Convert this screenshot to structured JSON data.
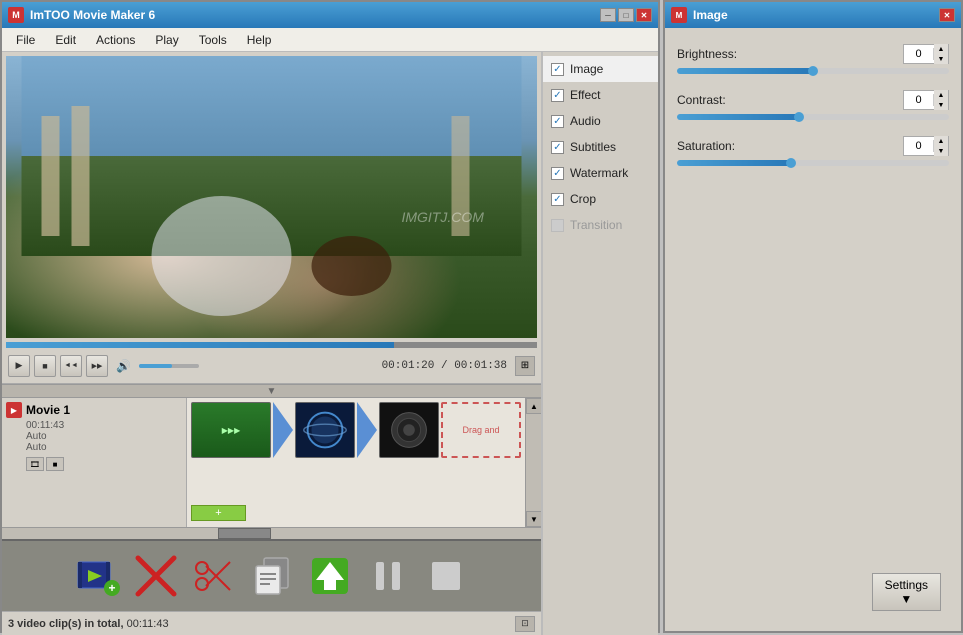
{
  "main_window": {
    "title": "ImTOO Movie Maker 6",
    "icon": "M",
    "controls": {
      "minimize": "─",
      "maximize": "□",
      "close": "✕"
    }
  },
  "menu": {
    "items": [
      {
        "label": "File",
        "id": "file"
      },
      {
        "label": "Edit",
        "id": "edit"
      },
      {
        "label": "Actions",
        "id": "actions"
      },
      {
        "label": "Play",
        "id": "play"
      },
      {
        "label": "Tools",
        "id": "tools"
      },
      {
        "label": "Help",
        "id": "help"
      }
    ]
  },
  "transport": {
    "play_btn": "▶",
    "stop_btn": "■",
    "prev_btn": "◄◄",
    "next_btn": "▶▶",
    "volume_icon": "🔊",
    "time_current": "00:01:20",
    "time_total": "00:01:38"
  },
  "timeline": {
    "track_name": "Movie 1",
    "track_duration": "00:11:43",
    "track_info1": "Auto",
    "track_info2": "Auto",
    "drag_text": "Drag and",
    "add_btn": "+"
  },
  "toolbar": {
    "add_video_label": "Add Video",
    "remove_label": "Remove",
    "scissors_label": "Split",
    "copy_label": "Copy",
    "export_label": "Export",
    "pause_label": "Pause",
    "stop_label": "Stop"
  },
  "status_bar": {
    "text": "3 video clip(s) in total, ",
    "duration": "00:11:43"
  },
  "image_panel": {
    "title": "Image",
    "icon": "M",
    "close_btn": "✕",
    "brightness": {
      "label": "Brightness:",
      "value": "0",
      "fill_pct": 50
    },
    "contrast": {
      "label": "Contrast:",
      "value": "0",
      "fill_pct": 45
    },
    "saturation": {
      "label": "Saturation:",
      "value": "0",
      "fill_pct": 42
    },
    "settings_btn": "Settings ▼"
  },
  "effects_sidebar": {
    "items": [
      {
        "label": "Image",
        "checked": true,
        "active": true,
        "disabled": false
      },
      {
        "label": "Effect",
        "checked": true,
        "active": false,
        "disabled": false
      },
      {
        "label": "Audio",
        "checked": true,
        "active": false,
        "disabled": false
      },
      {
        "label": "Subtitles",
        "checked": true,
        "active": false,
        "disabled": false
      },
      {
        "label": "Watermark",
        "checked": true,
        "active": false,
        "disabled": false
      },
      {
        "label": "Crop",
        "checked": true,
        "active": false,
        "disabled": false
      },
      {
        "label": "Transition",
        "checked": false,
        "active": false,
        "disabled": true
      }
    ]
  },
  "watermark_text": "IMGITJ.COM"
}
